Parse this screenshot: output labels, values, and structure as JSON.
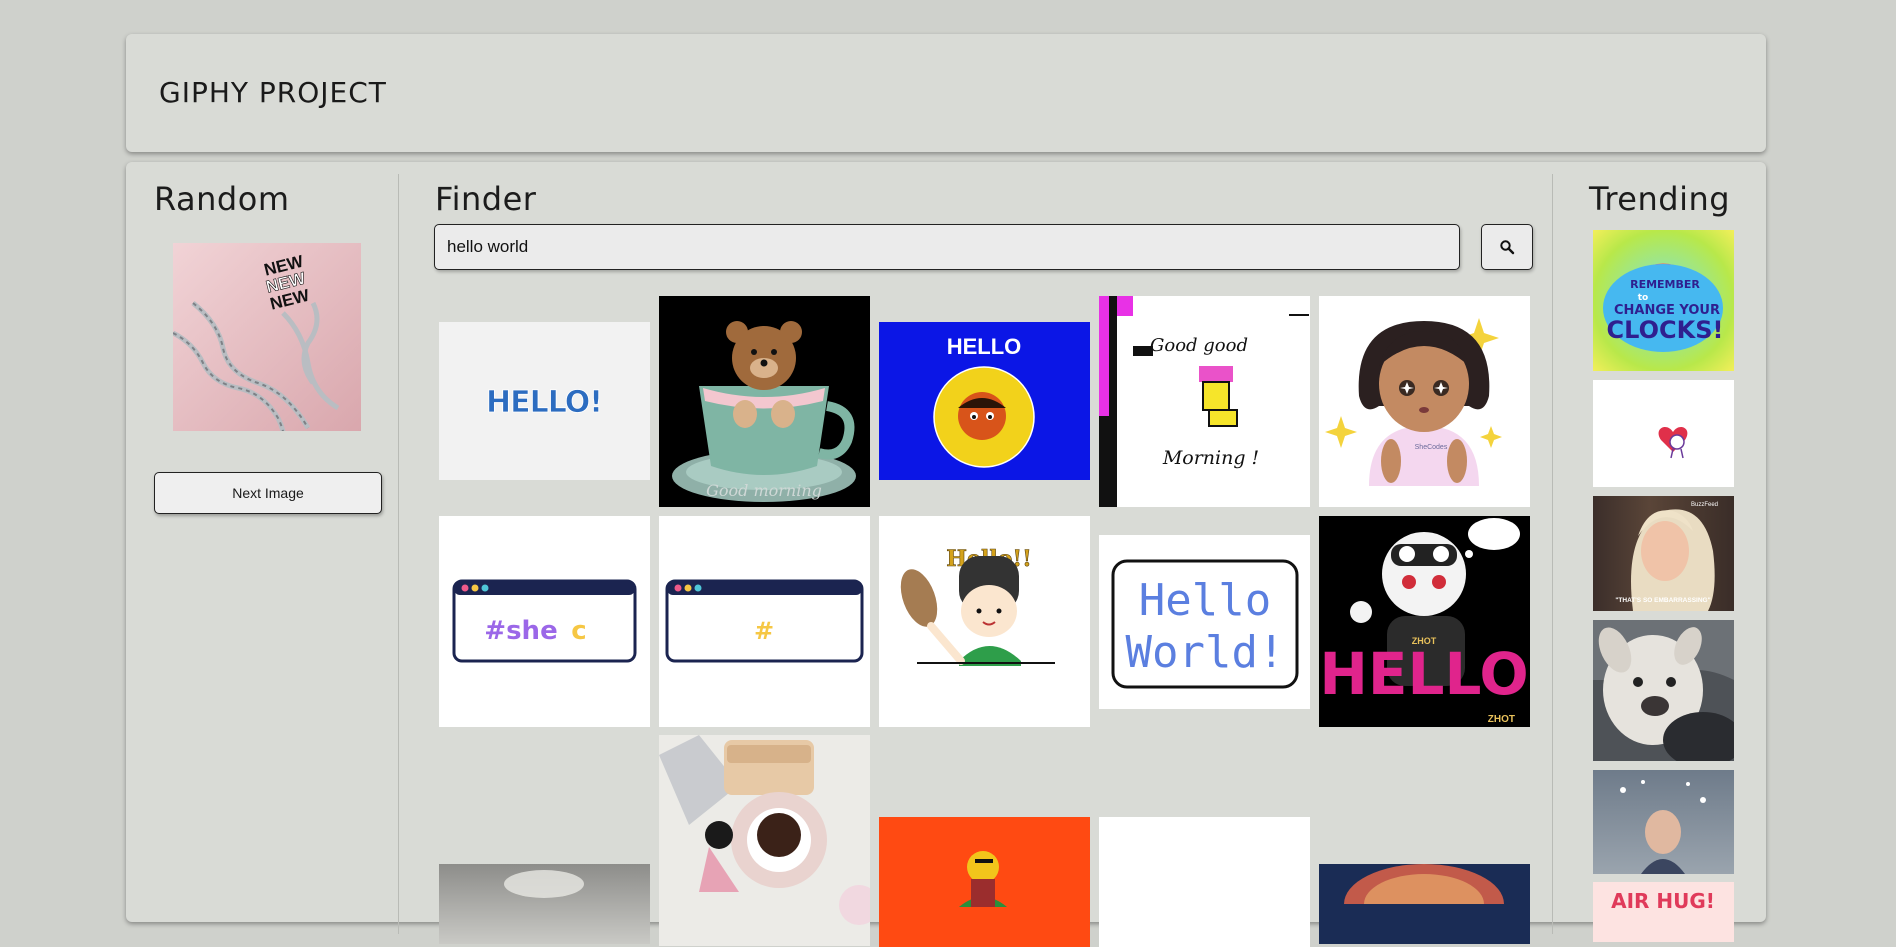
{
  "header": {
    "title": "GIPHY PROJECT"
  },
  "random": {
    "heading": "Random",
    "image_text": [
      "NEW",
      "NEW",
      "NEW"
    ],
    "next_button": "Next Image"
  },
  "finder": {
    "heading": "Finder",
    "search_value": "hello world",
    "search_icon": "search-icon",
    "results": {
      "hello_blocks": "HELLO!",
      "hello_blue": "HELLO",
      "good_morning": [
        "Good good",
        "Morning !"
      ],
      "she_c": [
        "#she",
        "c"
      ],
      "hash": "#",
      "hello_hat": "Hello!!",
      "hello_world_card": [
        "Hello",
        "World!"
      ],
      "hello_pink": "HELLO",
      "shecodes": "SheCodes",
      "teddy_caption": "Good morning",
      "zhot_top": "ZHOT",
      "zhot_corner": "ZHOT"
    }
  },
  "trending": {
    "heading": "Trending",
    "clocks": [
      "REMEMBER",
      "to",
      "CHANGE YOUR",
      "CLOCKS!"
    ],
    "embarrassing_caption": "\"THAT'S SO EMBARRASSING\"",
    "buzzfeed": "BuzzFeed",
    "airhug": "AIR HUG!"
  },
  "colors": {
    "page_bg": "#cfd1cc",
    "card_bg": "#d9dbd6",
    "hello_blue_bg": "#0b16e6",
    "orange_tile": "#ff4a12",
    "pink": "#e0248c",
    "purple": "#9b67e8"
  }
}
